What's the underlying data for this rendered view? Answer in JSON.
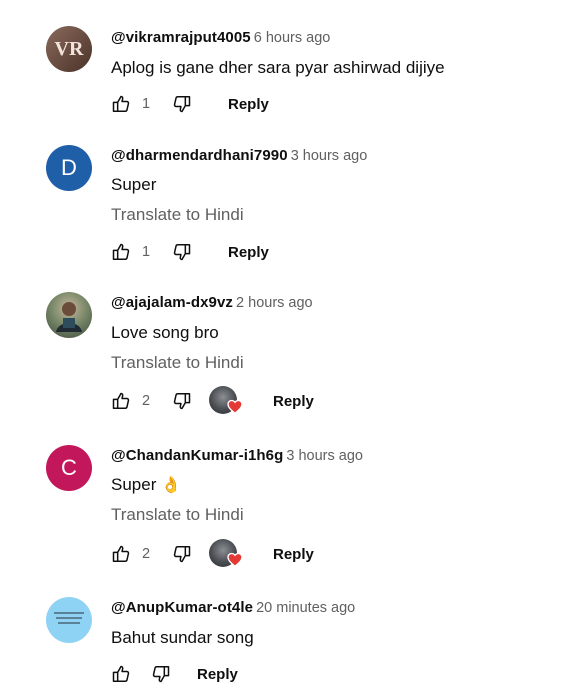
{
  "comments": [
    {
      "handle": "@vikramrajput4005",
      "time": "6 hours ago",
      "text": "Aplog is gane dher sara pyar ashirwad dijiye",
      "likes": "1",
      "reply": "Reply",
      "avatar_initials": "VR",
      "avatar_color": "#6b4a3a"
    },
    {
      "handle": "@dharmendardhani7990",
      "time": "3 hours ago",
      "text": "Super",
      "translate": "Translate to Hindi",
      "likes": "1",
      "reply": "Reply",
      "avatar_letter": "D",
      "avatar_color": "#1f5fa8"
    },
    {
      "handle": "@ajajalam-dx9vz",
      "time": "2 hours ago",
      "text": "Love song bro",
      "translate": "Translate to Hindi",
      "likes": "2",
      "reply": "Reply",
      "hearted": true
    },
    {
      "handle": "@ChandanKumar-i1h6g",
      "time": "3 hours ago",
      "text": "Super",
      "text_emoji": "👌",
      "translate": "Translate to Hindi",
      "likes": "2",
      "reply": "Reply",
      "avatar_letter": "C",
      "avatar_color": "#c2185b",
      "hearted": true
    },
    {
      "handle": "@AnupKumar-ot4le",
      "time": "20 minutes ago",
      "text": "Bahut sundar song",
      "reply": "Reply",
      "avatar_color": "#8fd3f4"
    }
  ],
  "colors": {
    "secondary_text": "#606060",
    "primary_text": "#0f0f0f",
    "heart": "#e53935"
  }
}
